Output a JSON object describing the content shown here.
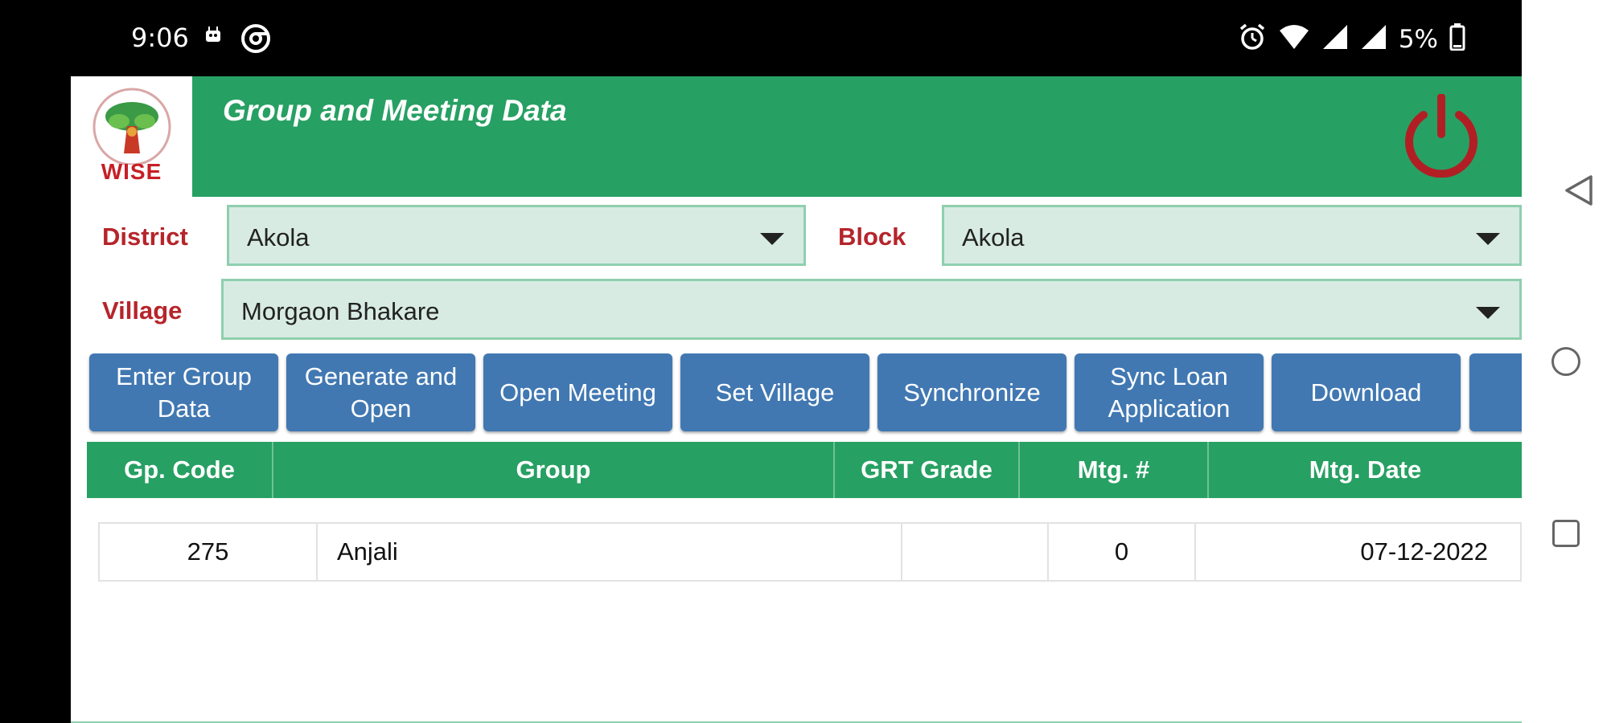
{
  "status_bar": {
    "time": "9:06",
    "battery": "5%",
    "icons": [
      "android-notification-icon",
      "chrome-icon",
      "alarm-icon",
      "wifi-icon",
      "signal-icon",
      "signal-icon",
      "battery-icon"
    ]
  },
  "header": {
    "logo_text": "WISE",
    "title": "Group and Meeting Data",
    "accent_color": "#27a063",
    "power_color": "#b11f24"
  },
  "filters": {
    "district_label": "District",
    "district_value": "Akola",
    "block_label": "Block",
    "block_value": "Akola",
    "village_label": "Village",
    "village_value": "Morgaon Bhakare"
  },
  "toolbar": {
    "enter_group_data": "Enter Group\nData",
    "generate_and_open": "Generate and\nOpen",
    "open_meeting": "Open Meeting",
    "set_village": "Set Village",
    "synchronize": "Synchronize",
    "sync_loan_application": "Sync Loan\nApplication",
    "download": "Download"
  },
  "table": {
    "headers": [
      "Gp. Code",
      "Group",
      "GRT Grade",
      "Mtg. #",
      "Mtg. Date"
    ],
    "rows": [
      {
        "gp_code": "275",
        "group": "Anjali",
        "grt_grade": "",
        "mtg_no": "0",
        "mtg_date": "07-12-2022"
      }
    ]
  }
}
